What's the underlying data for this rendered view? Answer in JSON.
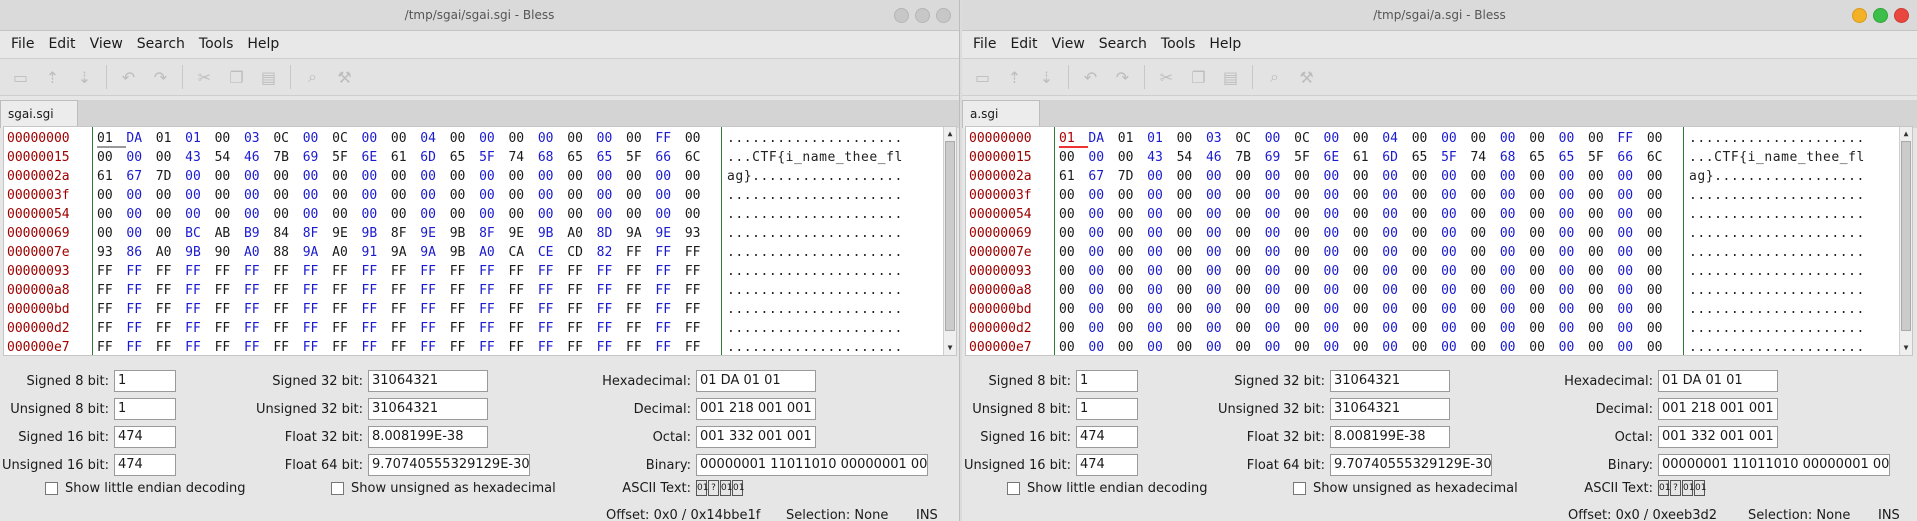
{
  "windows": [
    {
      "title": "/tmp/sgai/sgai.sgi - Bless",
      "tab_label": "sgai.sgi",
      "menu": [
        "File",
        "Edit",
        "View",
        "Search",
        "Tools",
        "Help"
      ],
      "toolbar_icons": [
        "new-file-icon",
        "open-icon",
        "save-icon",
        "undo-icon",
        "redo-icon",
        "cut-icon",
        "copy-icon",
        "paste-icon",
        "find-icon",
        "replace-icon"
      ],
      "offsets": [
        "00000000",
        "00000015",
        "0000002a",
        "0000003f",
        "00000054",
        "00000069",
        "0000007e",
        "00000093",
        "000000a8",
        "000000bd",
        "000000d2",
        "000000e7"
      ],
      "hex_rows": [
        "01 DA 01 01 00 03 0C 00 0C 00 00 04 00 00 00 00 00 00 00 FF 00",
        "00 00 00 43 54 46 7B 69 5F 6E 61 6D 65 5F 74 68 65 65 5F 66 6C",
        "61 67 7D 00 00 00 00 00 00 00 00 00 00 00 00 00 00 00 00 00 00",
        "00 00 00 00 00 00 00 00 00 00 00 00 00 00 00 00 00 00 00 00 00",
        "00 00 00 00 00 00 00 00 00 00 00 00 00 00 00 00 00 00 00 00 00",
        "00 00 00 BC AB B9 84 8F 9E 9B 8F 9E 9B 8F 9E 9B A0 8D 9A 9E 93",
        "93 86 A0 9B 90 A0 88 9A A0 91 9A 9A 9B A0 CA CE CD 82 FF FF FF",
        "FF FF FF FF FF FF FF FF FF FF FF FF FF FF FF FF FF FF FF FF FF",
        "FF FF FF FF FF FF FF FF FF FF FF FF FF FF FF FF FF FF FF FF FF",
        "FF FF FF FF FF FF FF FF FF FF FF FF FF FF FF FF FF FF FF FF FF",
        "FF FF FF FF FF FF FF FF FF FF FF FF FF FF FF FF FF FF FF FF FF",
        "FF FF FF FF FF FF FF FF FF FF FF FF FF FF FF FF FF FF FF FF FF"
      ],
      "ascii_rows": [
        ".....................",
        "...CTF{i_name_thee_fl",
        "ag}..................",
        ".....................",
        ".....................",
        ".....................",
        ".....................",
        ".....................",
        ".....................",
        ".....................",
        ".....................",
        "....................."
      ],
      "conv": {
        "signed8_label": "Signed 8 bit:",
        "signed8": "1",
        "unsigned8_label": "Unsigned 8 bit:",
        "unsigned8": "1",
        "signed16_label": "Signed 16 bit:",
        "signed16": "474",
        "unsigned16_label": "Unsigned 16 bit:",
        "unsigned16": "474",
        "signed32_label": "Signed 32 bit:",
        "signed32": "31064321",
        "unsigned32_label": "Unsigned 32 bit:",
        "unsigned32": "31064321",
        "float32_label": "Float 32 bit:",
        "float32": "8.008199E-38",
        "float64_label": "Float 64 bit:",
        "float64": "9.70740555329129E-300",
        "hex_label": "Hexadecimal:",
        "hex": "01 DA 01 01",
        "dec_label": "Decimal:",
        "dec": "001 218 001 001",
        "oct_label": "Octal:",
        "oct": "001 332 001 001",
        "bin_label": "Binary:",
        "bin": "00000001 11011010 00000001 00000001",
        "ascii_label": "ASCII Text:",
        "ascii_glyphs": [
          "01",
          "?",
          "01",
          "01"
        ],
        "little_endian_label": "Show little endian decoding",
        "unsigned_hex_label": "Show unsigned as hexadecimal"
      },
      "status": {
        "offset": "Offset: 0x0 / 0x14bbe1f",
        "selection": "Selection: None",
        "mode": "INS"
      }
    },
    {
      "title": "/tmp/sgai/a.sgi - Bless",
      "tab_label": "a.sgi",
      "menu": [
        "File",
        "Edit",
        "View",
        "Search",
        "Tools",
        "Help"
      ],
      "toolbar_icons": [
        "new-file-icon",
        "open-icon",
        "save-icon",
        "undo-icon",
        "redo-icon",
        "cut-icon",
        "copy-icon",
        "paste-icon",
        "find-icon",
        "replace-icon"
      ],
      "offsets": [
        "00000000",
        "00000015",
        "0000002a",
        "0000003f",
        "00000054",
        "00000069",
        "0000007e",
        "00000093",
        "000000a8",
        "000000bd",
        "000000d2",
        "000000e7"
      ],
      "hex_rows": [
        "01 DA 01 01 00 03 0C 00 0C 00 00 04 00 00 00 00 00 00 00 FF 00",
        "00 00 00 43 54 46 7B 69 5F 6E 61 6D 65 5F 74 68 65 65 5F 66 6C",
        "61 67 7D 00 00 00 00 00 00 00 00 00 00 00 00 00 00 00 00 00 00",
        "00 00 00 00 00 00 00 00 00 00 00 00 00 00 00 00 00 00 00 00 00",
        "00 00 00 00 00 00 00 00 00 00 00 00 00 00 00 00 00 00 00 00 00",
        "00 00 00 00 00 00 00 00 00 00 00 00 00 00 00 00 00 00 00 00 00",
        "00 00 00 00 00 00 00 00 00 00 00 00 00 00 00 00 00 00 00 00 00",
        "00 00 00 00 00 00 00 00 00 00 00 00 00 00 00 00 00 00 00 00 00",
        "00 00 00 00 00 00 00 00 00 00 00 00 00 00 00 00 00 00 00 00 00",
        "00 00 00 00 00 00 00 00 00 00 00 00 00 00 00 00 00 00 00 00 00",
        "00 00 00 00 00 00 00 00 00 00 00 00 00 00 00 00 00 00 00 00 00",
        "00 00 00 00 00 00 00 00 00 00 00 00 00 00 00 00 00 00 00 00 00"
      ],
      "ascii_rows": [
        ".....................",
        "...CTF{i_name_thee_fl",
        "ag}..................",
        ".....................",
        ".....................",
        ".....................",
        ".....................",
        ".....................",
        ".....................",
        ".....................",
        ".....................",
        "....................."
      ],
      "conv": {
        "signed8_label": "Signed 8 bit:",
        "signed8": "1",
        "unsigned8_label": "Unsigned 8 bit:",
        "unsigned8": "1",
        "signed16_label": "Signed 16 bit:",
        "signed16": "474",
        "unsigned16_label": "Unsigned 16 bit:",
        "unsigned16": "474",
        "signed32_label": "Signed 32 bit:",
        "signed32": "31064321",
        "unsigned32_label": "Unsigned 32 bit:",
        "unsigned32": "31064321",
        "float32_label": "Float 32 bit:",
        "float32": "8.008199E-38",
        "float64_label": "Float 64 bit:",
        "float64": "9.70740555329129E-300",
        "hex_label": "Hexadecimal:",
        "hex": "01 DA 01 01",
        "dec_label": "Decimal:",
        "dec": "001 218 001 001",
        "oct_label": "Octal:",
        "oct": "001 332 001 001",
        "bin_label": "Binary:",
        "bin": "00000001 11011010 00000001 00000001",
        "ascii_label": "ASCII Text:",
        "ascii_glyphs": [
          "01",
          "?",
          "01",
          "01"
        ],
        "little_endian_label": "Show little endian decoding",
        "unsigned_hex_label": "Show unsigned as hexadecimal"
      },
      "status": {
        "offset": "Offset: 0x0 / 0xeeb3d2",
        "selection": "Selection: None",
        "mode": "INS"
      }
    }
  ]
}
